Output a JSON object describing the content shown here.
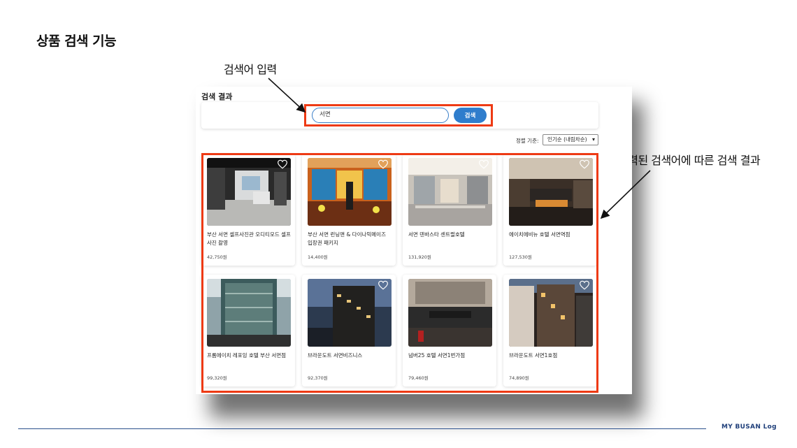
{
  "slide_title": "상품 검색 기능",
  "callouts": {
    "input": "검색어 입력",
    "results": "입력된 검색어에 따른 검색 결과"
  },
  "screen": {
    "results_heading": "검색 결과",
    "search": {
      "value": "서면",
      "button_label": "검색"
    },
    "sort": {
      "label": "정렬 기준:",
      "selected": "인기순 (내림차순)"
    },
    "products": [
      {
        "title": "부산 서면 셀프사진관 오디티모드 셀프 사진 촬영",
        "price": "42,750원",
        "icon": "heart-icon"
      },
      {
        "title": "부산 서면 런닝맨 & 다이나믹메이즈 입장권 패키지",
        "price": "14,400원",
        "icon": "heart-icon"
      },
      {
        "title": "서면 덴바스타 센트럴호텔",
        "price": "131,920원",
        "icon": "heart-icon"
      },
      {
        "title": "에이치에비뉴 호텔 서면역점",
        "price": "127,530원",
        "icon": "heart-icon"
      },
      {
        "title": "프롬에이치 레포잉 호텔 부산 서면점",
        "price": "99,320원",
        "icon": "heart-icon"
      },
      {
        "title": "브라운도트 서면비즈니스",
        "price": "92,370원",
        "icon": "heart-icon"
      },
      {
        "title": "넘버25 호텔 서면1번가점",
        "price": "79,460원",
        "icon": "heart-icon"
      },
      {
        "title": "브라운도트 서면1호점",
        "price": "74,890원",
        "icon": "heart-icon"
      }
    ]
  },
  "footer": {
    "brand": "MY BUSAN Log"
  },
  "colors": {
    "highlight": "#ee3a14",
    "accent": "#2f7dcc",
    "footer": "#1f3f7a"
  }
}
